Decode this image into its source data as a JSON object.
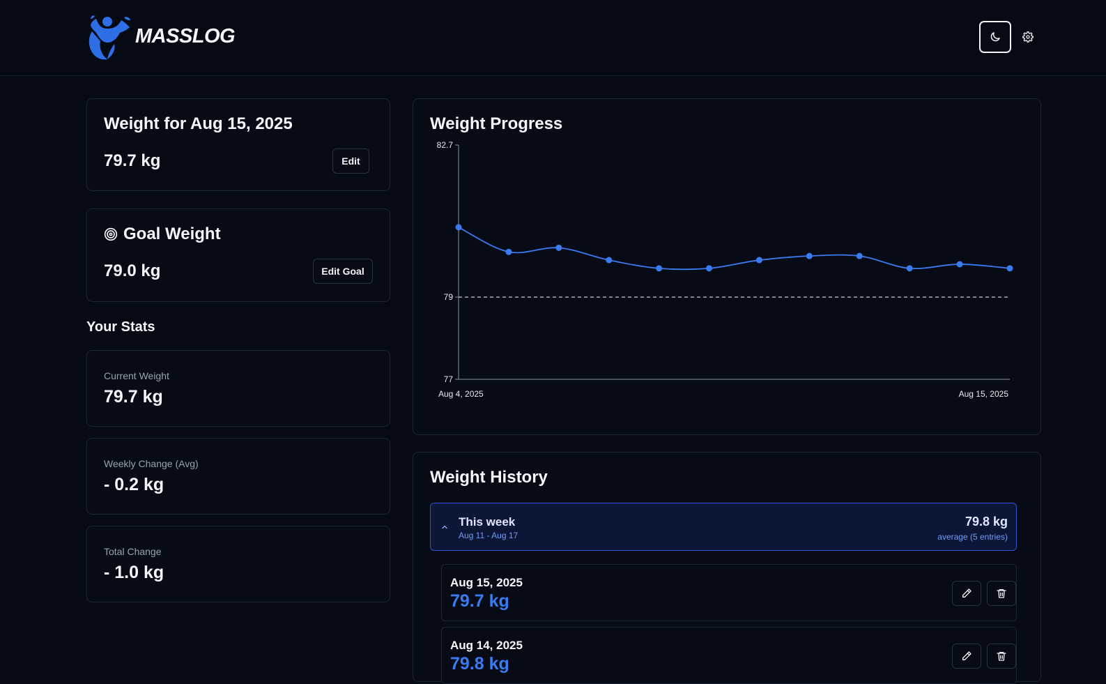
{
  "app": {
    "name": "MASSLOG"
  },
  "colors": {
    "accent": "#3b7bf2",
    "background": "#050a14",
    "card_border": "#1d2433"
  },
  "today_card": {
    "title": "Weight for Aug 15, 2025",
    "value": "79.7 kg",
    "edit_label": "Edit"
  },
  "goal_card": {
    "icon": "target-icon",
    "title": "Goal Weight",
    "value": "79.0 kg",
    "edit_label": "Edit Goal"
  },
  "stats": {
    "title": "Your Stats",
    "items": [
      {
        "label": "Current Weight",
        "value": "79.7 kg"
      },
      {
        "label": "Weekly Change (Avg)",
        "value": "- 0.2 kg"
      },
      {
        "label": "Total Change",
        "value": "- 1.0 kg"
      }
    ]
  },
  "progress": {
    "title": "Weight Progress",
    "chart_data": {
      "type": "line",
      "x": [
        "Aug 4, 2025",
        "Aug 5, 2025",
        "Aug 6, 2025",
        "Aug 7, 2025",
        "Aug 8, 2025",
        "Aug 9, 2025",
        "Aug 10, 2025",
        "Aug 11, 2025",
        "Aug 12, 2025",
        "Aug 13, 2025",
        "Aug 14, 2025",
        "Aug 15, 2025"
      ],
      "values": [
        80.7,
        80.1,
        80.2,
        79.9,
        79.7,
        79.7,
        79.9,
        80.0,
        80.0,
        79.7,
        79.8,
        79.7
      ],
      "x_tick_labels": [
        "Aug 4, 2025",
        "Aug 15, 2025"
      ],
      "y_ticks": [
        "82.7",
        "79",
        "77"
      ],
      "ylim": [
        77,
        82.7
      ],
      "goal_line": 79,
      "grid": false,
      "series_color": "#3b7bf2"
    }
  },
  "history": {
    "title": "Weight History",
    "week": {
      "label": "This week",
      "range": "Aug 11 - Aug 17",
      "average": "79.8 kg",
      "average_note": "average (5 entries)"
    },
    "entries": [
      {
        "date": "Aug 15, 2025",
        "weight": "79.7 kg"
      },
      {
        "date": "Aug 14, 2025",
        "weight": "79.8 kg"
      }
    ]
  }
}
